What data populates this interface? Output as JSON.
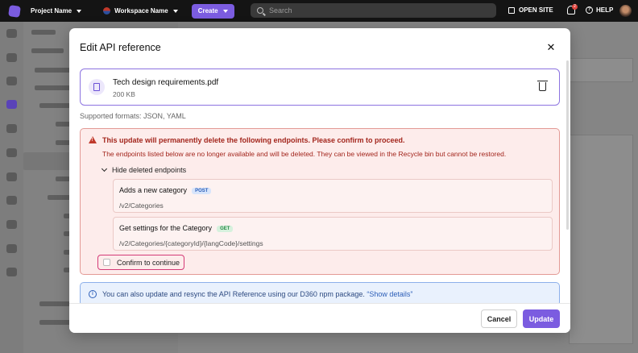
{
  "topbar": {
    "project_name": "Project Name",
    "workspace_name": "Workspace Name",
    "create_label": "Create",
    "search_placeholder": "Search",
    "open_site_label": "OPEN SITE",
    "notification_count": "2",
    "help_label": "HELP"
  },
  "modal": {
    "title": "Edit API reference",
    "close_icon": "close-icon",
    "file": {
      "name": "Tech design requirements.pdf",
      "size": "200 KB"
    },
    "supported_formats": "Supported formats: JSON, YAML",
    "warning": {
      "title": "This update will permanently delete the following endpoints. Please confirm to proceed.",
      "description": "The endpoints listed below are no longer available and will be deleted. They can be viewed in the Recycle bin but cannot be restored.",
      "toggle_label": "Hide deleted endpoints",
      "endpoints": [
        {
          "name": "Adds a new category",
          "method": "POST",
          "path": "/v2/Categories"
        },
        {
          "name": "Get settings for the Category",
          "method": "GET",
          "path": "/v2/Categories/{categoryId}/{langCode}/settings"
        }
      ],
      "confirm_label": "Confirm to continue"
    },
    "info": {
      "text": "You can also update and resync the API Reference using our D360 npm package.",
      "link": "“Show details”"
    },
    "cancel_label": "Cancel",
    "update_label": "Update"
  },
  "colors": {
    "accent": "#7b5ce0",
    "danger": "#a3261d",
    "info": "#2d5fb8"
  }
}
